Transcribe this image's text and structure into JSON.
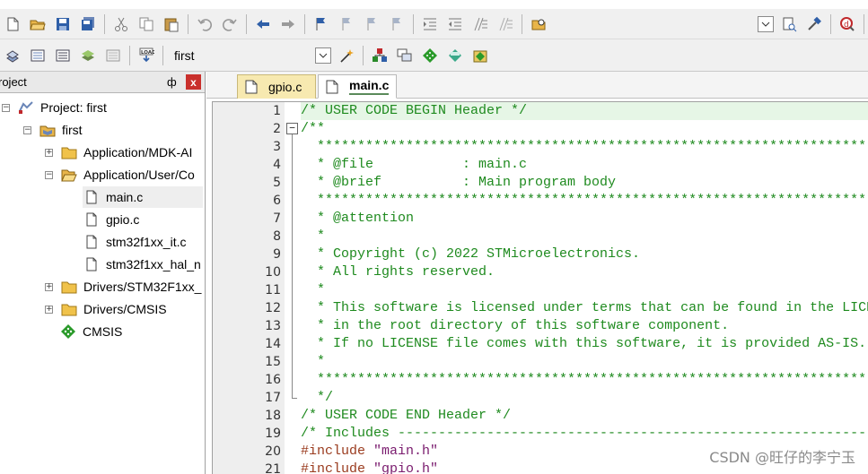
{
  "toolbar": {
    "target_name": "first"
  },
  "project_panel": {
    "title": "roject",
    "pin_glyph": "ф",
    "close_glyph": "x",
    "tree": [
      {
        "label": "Project: first",
        "icon": "project-icon",
        "expander": "−"
      },
      {
        "label": "first",
        "icon": "target-icon",
        "expander": "−"
      },
      {
        "label": "Application/MDK-AI",
        "icon": "folder-icon",
        "expander": "+"
      },
      {
        "label": "Application/User/Co",
        "icon": "folder-open-icon",
        "expander": "−"
      },
      {
        "label": "main.c",
        "icon": "file-icon",
        "expander": ""
      },
      {
        "label": "gpio.c",
        "icon": "file-icon",
        "expander": ""
      },
      {
        "label": "stm32f1xx_it.c",
        "icon": "file-icon",
        "expander": ""
      },
      {
        "label": "stm32f1xx_hal_n",
        "icon": "file-icon",
        "expander": ""
      },
      {
        "label": "Drivers/STM32F1xx_",
        "icon": "folder-icon",
        "expander": "+"
      },
      {
        "label": "Drivers/CMSIS",
        "icon": "folder-icon",
        "expander": "+"
      },
      {
        "label": "CMSIS",
        "icon": "component-icon",
        "expander": ""
      }
    ]
  },
  "editor": {
    "tabs": [
      {
        "label": "gpio.c",
        "active": false
      },
      {
        "label": "main.c",
        "active": true
      }
    ],
    "lines": [
      {
        "no": "1",
        "text": "/* USER CODE BEGIN Header */"
      },
      {
        "no": "2",
        "text": "/**"
      },
      {
        "no": "3",
        "text": "  ******************************************************************************"
      },
      {
        "no": "4",
        "text": "  * @file           : main.c"
      },
      {
        "no": "5",
        "text": "  * @brief          : Main program body"
      },
      {
        "no": "6",
        "text": "  ******************************************************************************"
      },
      {
        "no": "7",
        "text": "  * @attention"
      },
      {
        "no": "8",
        "text": "  *"
      },
      {
        "no": "9",
        "text": "  * Copyright (c) 2022 STMicroelectronics."
      },
      {
        "no": "10",
        "text": "  * All rights reserved."
      },
      {
        "no": "11",
        "text": "  *"
      },
      {
        "no": "12",
        "text": "  * This software is licensed under terms that can be found in the LICENSE file"
      },
      {
        "no": "13",
        "text": "  * in the root directory of this software component."
      },
      {
        "no": "14",
        "text": "  * If no LICENSE file comes with this software, it is provided AS-IS."
      },
      {
        "no": "15",
        "text": "  *"
      },
      {
        "no": "16",
        "text": "  ******************************************************************************"
      },
      {
        "no": "17",
        "text": "  */"
      },
      {
        "no": "18",
        "text": "/* USER CODE END Header */"
      },
      {
        "no": "19",
        "text": "/* Includes ------------------------------------------------------------------*/"
      },
      {
        "no": "20",
        "pre": "#include ",
        "str": "\"main.h\""
      },
      {
        "no": "21",
        "pre": "#include ",
        "str": "\"gpio.h\""
      }
    ],
    "fold_open_glyph": "−"
  },
  "watermark": "CSDN @旺仔的李宁玉"
}
